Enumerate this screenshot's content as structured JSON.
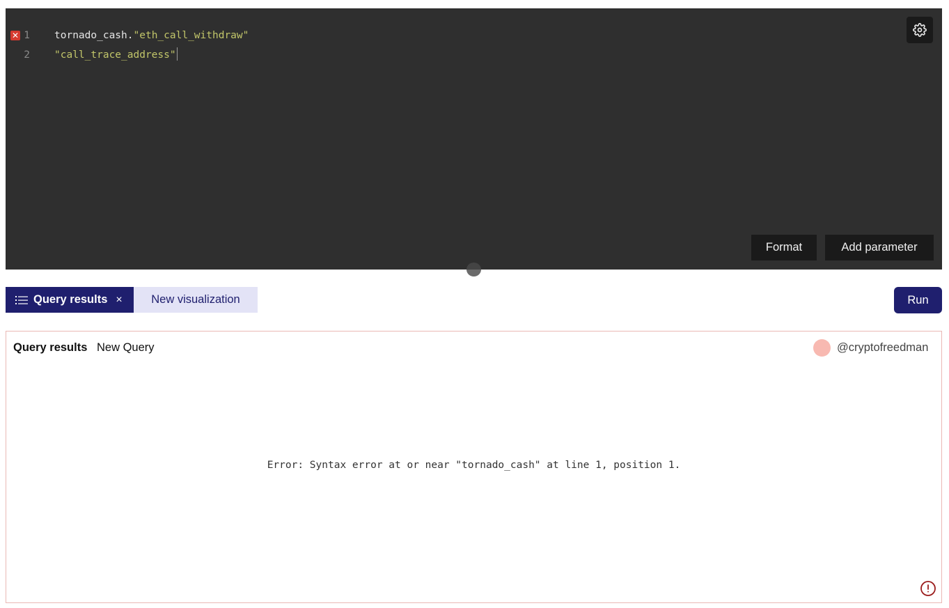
{
  "editor": {
    "lines": [
      {
        "number": "1",
        "has_error": true,
        "error_marker": "✕",
        "tokens": [
          {
            "text": "tornado_cash.",
            "kind": "identifier"
          },
          {
            "text": "\"eth_call_withdraw\"",
            "kind": "string"
          }
        ]
      },
      {
        "number": "2",
        "has_error": false,
        "tokens": [
          {
            "text": "\"call_trace_address\"",
            "kind": "string"
          }
        ]
      }
    ],
    "settings_icon": "gear-icon",
    "format_label": "Format",
    "add_parameter_label": "Add parameter"
  },
  "tabs": {
    "query_results_label": "Query results",
    "query_results_icon": "list-icon",
    "close_glyph": "×",
    "new_visualization_label": "New visualization"
  },
  "run_label": "Run",
  "results": {
    "title": "Query results",
    "query_name": "New Query",
    "username": "@cryptofreedman",
    "error_message": "Error: Syntax error at or near \"tornado_cash\" at line 1, position 1.",
    "alert_icon": "alert-circle-icon"
  },
  "colors": {
    "editor_bg": "#2f2f2f",
    "string_token": "#c2c66a",
    "accent": "#1f1f6e",
    "tab_inactive_bg": "#e3e3f6",
    "error_marker": "#d63a2f",
    "avatar": "#f8b9b1",
    "panel_border": "#eab8b4"
  }
}
